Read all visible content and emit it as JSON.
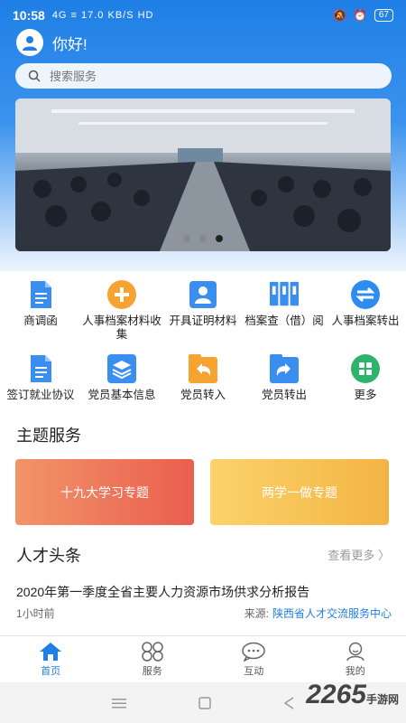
{
  "status": {
    "time": "10:58",
    "net": "4G ≡ 17.0 KB/S HD",
    "battery": "67"
  },
  "header": {
    "greeting": "你好!"
  },
  "search": {
    "placeholder": "搜索服务"
  },
  "banner": {
    "active_index": 2,
    "count": 3
  },
  "services": [
    {
      "label": "商调函",
      "icon": "document-icon"
    },
    {
      "label": "人事档案材料收集",
      "icon": "plus-circle-icon"
    },
    {
      "label": "开具证明材料",
      "icon": "person-card-icon"
    },
    {
      "label": "档案查（借）阅",
      "icon": "binders-icon"
    },
    {
      "label": "人事档案转出",
      "icon": "transfer-circle-icon"
    },
    {
      "label": "签订就业协议",
      "icon": "agreement-doc-icon"
    },
    {
      "label": "党员基本信息",
      "icon": "layers-icon"
    },
    {
      "label": "党员转入",
      "icon": "return-arrow-icon"
    },
    {
      "label": "党员转出",
      "icon": "share-arrow-icon"
    },
    {
      "label": "更多",
      "icon": "grid-more-icon"
    }
  ],
  "themes": {
    "title": "主题服务",
    "items": [
      "十九大学习专题",
      "两学一做专题"
    ]
  },
  "news": {
    "title": "人才头条",
    "more": "查看更多 〉",
    "headline": "2020年第一季度全省主要人力资源市场供求分析报告",
    "time": "1小时前",
    "source_label": "来源:",
    "source": "陕西省人才交流服务中心"
  },
  "tabs": [
    {
      "label": "首页",
      "icon": "home-icon",
      "active": true
    },
    {
      "label": "服务",
      "icon": "services-icon",
      "active": false
    },
    {
      "label": "互动",
      "icon": "chat-icon",
      "active": false
    },
    {
      "label": "我的",
      "icon": "user-icon",
      "active": false
    }
  ],
  "watermark": {
    "brand": "2265",
    "site": "手游网"
  },
  "colors": {
    "primary": "#1f7fe6",
    "theme1": "#ea5e4e",
    "theme2": "#f3b444"
  }
}
